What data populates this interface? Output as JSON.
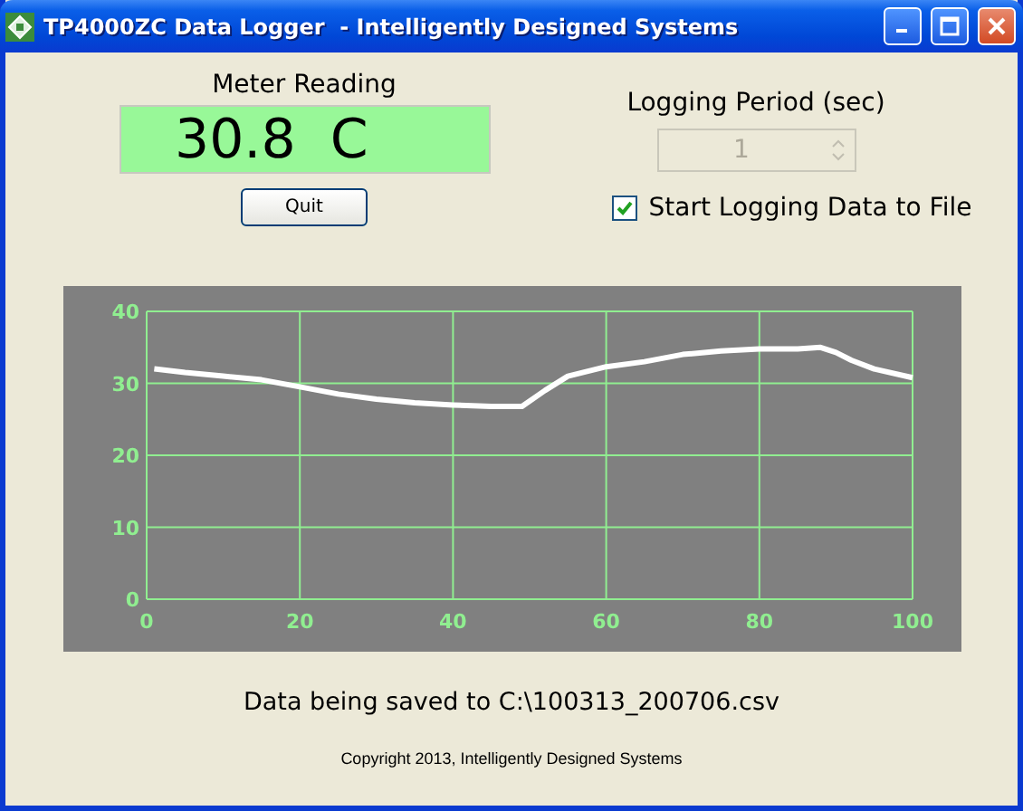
{
  "window": {
    "title": "TP4000ZC Data Logger  - Intelligently Designed Systems"
  },
  "meter": {
    "label": "Meter Reading",
    "value": "30.8  C"
  },
  "quit_button": {
    "label": "Quit"
  },
  "logging_period": {
    "label": "Logging Period (sec)",
    "value": "1",
    "disabled": true
  },
  "start_logging": {
    "label": "Start Logging Data to File",
    "checked": true
  },
  "plot": {
    "chart_data": {
      "type": "line",
      "grid": true,
      "xlim": [
        0,
        100
      ],
      "ylim": [
        0,
        40
      ],
      "xticks": [
        0,
        20,
        40,
        60,
        80,
        100
      ],
      "yticks": [
        0,
        10,
        20,
        30,
        40
      ],
      "x": [
        1,
        5,
        10,
        15,
        20,
        25,
        30,
        35,
        40,
        45,
        49,
        52,
        55,
        60,
        65,
        70,
        75,
        80,
        85,
        88,
        90,
        92,
        95,
        100
      ],
      "series": [
        {
          "color": "#ffffff",
          "values": [
            32,
            31.5,
            31,
            30.5,
            29.5,
            28.5,
            27.8,
            27.3,
            27,
            26.8,
            26.8,
            29,
            31,
            32.3,
            33,
            34,
            34.5,
            34.8,
            34.8,
            35,
            34.3,
            33.2,
            32,
            30.8
          ]
        }
      ]
    }
  },
  "status": "Data being saved to C:\\100313_200706.csv",
  "copyright": "Copyright 2013, Intelligently Designed Systems"
}
